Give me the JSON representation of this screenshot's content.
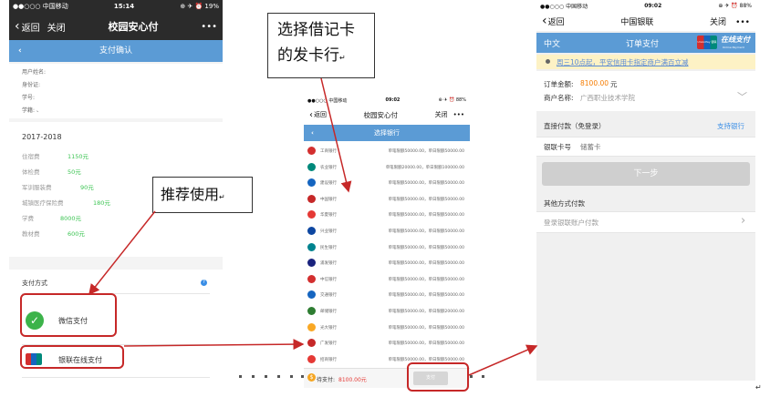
{
  "phone1": {
    "status": {
      "carrier": "●●○○○ 中国移动 ",
      "time": "15:14",
      "battery": "⊕ ✈ ⏰ 19%"
    },
    "nav": {
      "back": "返回",
      "close": "关闭",
      "title": "校园安心付",
      "more": "•••"
    },
    "subheader": {
      "title": "支付确认"
    },
    "user_fields": [
      "用户姓名:",
      "身份证:",
      "学号:",
      "学籍: 、"
    ],
    "year": "2017-2018",
    "fees": [
      {
        "name": "住宿费",
        "amount": "1150元"
      },
      {
        "name": "体检费",
        "amount": "50元"
      },
      {
        "name": "军训服装费",
        "amount": "90元"
      },
      {
        "name": "城镇医疗保险费",
        "amount": "180元"
      },
      {
        "name": "学费",
        "amount": "8000元"
      },
      {
        "name": "教材费",
        "amount": "600元"
      }
    ],
    "payment_method_label": "支付方式",
    "methods": {
      "wechat": "微信支付",
      "unionpay": "银联在线支付"
    }
  },
  "phone2": {
    "status": {
      "carrier": "●●○○○ 中国移动 ",
      "time": "09:02",
      "battery": "⊕ ✈ ⏰ 88%"
    },
    "nav": {
      "back": "返回",
      "close": "关闭",
      "title": "校园安心付",
      "more": "•••"
    },
    "subheader": {
      "title": "选择银行"
    },
    "banks": [
      {
        "name": "工商银行",
        "limit": "单笔限额50000.00，单日限额50000.00",
        "color": "#d32f2f"
      },
      {
        "name": "农业银行",
        "limit": "单笔限额20000.00，单日限额100000.00",
        "color": "#00897b"
      },
      {
        "name": "建设银行",
        "limit": "单笔限额50000.00，单日限额50000.00",
        "color": "#1565c0"
      },
      {
        "name": "中国银行",
        "limit": "单笔限额50000.00，单日限额50000.00",
        "color": "#c62828"
      },
      {
        "name": "华夏银行",
        "limit": "单笔限额50000.00，单日限额50000.00",
        "color": "#e53935"
      },
      {
        "name": "兴业银行",
        "limit": "单笔限额50000.00，单日限额50000.00",
        "color": "#0d47a1"
      },
      {
        "name": "民生银行",
        "limit": "单笔限额50000.00，单日限额50000.00",
        "color": "#00838f"
      },
      {
        "name": "浦发银行",
        "limit": "单笔限额50000.00，单日限额50000.00",
        "color": "#1a237e"
      },
      {
        "name": "中信银行",
        "limit": "单笔限额50000.00，单日限额50000.00",
        "color": "#d32f2f"
      },
      {
        "name": "交通银行",
        "limit": "单笔限额50000.00，单日限额50000.00",
        "color": "#1565c0"
      },
      {
        "name": "邮储银行",
        "limit": "单笔限额50000.00，单日限额20000.00",
        "color": "#2e7d32"
      },
      {
        "name": "光大银行",
        "limit": "单笔限额50000.00，单日限额50000.00",
        "color": "#f9a825"
      },
      {
        "name": "广发银行",
        "limit": "单笔限额50000.00，单日限额50000.00",
        "color": "#c62828"
      },
      {
        "name": "招商银行",
        "limit": "单笔限额50000.00，单日限额50000.00",
        "color": "#e53935"
      }
    ],
    "footer": {
      "label": "待支付:",
      "amount": "8100.00元",
      "button": "支付"
    }
  },
  "phone3": {
    "status": {
      "carrier": "●●○○○ 中国移动 ",
      "time": "09:02",
      "battery": "⊕ ✈ ⏰ 88%"
    },
    "nav": {
      "back": "返回",
      "close": "关闭",
      "title": "中国银联",
      "more": "•••"
    },
    "lang": "中文",
    "page_title": "订单支付",
    "brand": {
      "logo": "UnionPay 银联",
      "slogan": "在线支付",
      "slogan_en": "Online Payment"
    },
    "notice": "周三10点起，平安信用卡指定商户满百立减",
    "order_amount_label": "订单金额:",
    "order_amount": "8100.00",
    "order_amount_unit": "元",
    "merchant_label": "商户名称:",
    "merchant": "广西职业技术学院",
    "direct_pay_label": "直接付款（免登录）",
    "supported_banks": "支持银行",
    "card_label": "银联卡号",
    "card_placeholder": "储蓄卡",
    "next_button": "下一步",
    "other_methods": "其他方式付款",
    "login_pay": "登录银联账户付款"
  },
  "annotations": {
    "choose_debit": "选择借记卡的发卡行",
    "recommend": "推荐使用"
  },
  "colors": {
    "nav_dark": "#2b2b2b",
    "accent_blue": "#5b9bd5",
    "annotation_red": "#c62828"
  }
}
